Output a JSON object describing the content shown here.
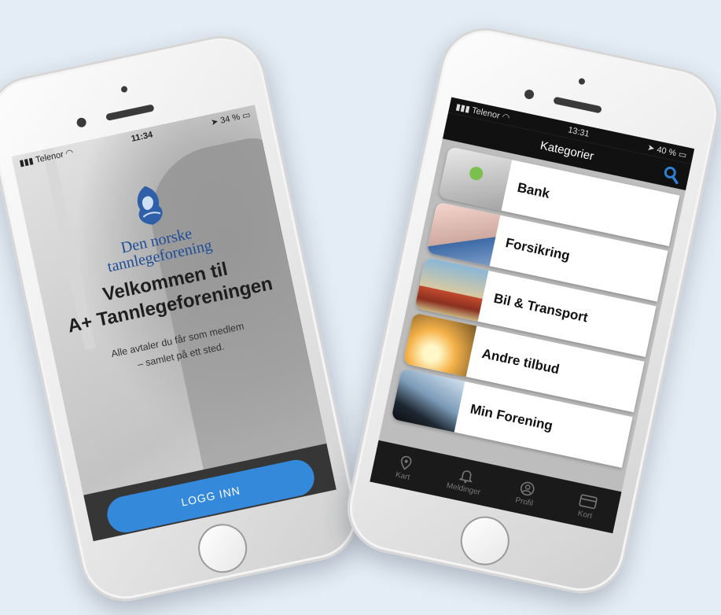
{
  "left_phone": {
    "status": {
      "carrier": "Telenor",
      "time": "11:34",
      "battery": "34 %"
    },
    "logo": {
      "line1": "Den norske",
      "line2": "tannlegeforening"
    },
    "welcome": {
      "line1": "Velkommen til",
      "line2": "A+ Tannlegeforeningen"
    },
    "subtitle": {
      "line1": "Alle avtaler du får som medlem",
      "line2": "– samlet på ett sted."
    },
    "login_label": "LOGG INN"
  },
  "right_phone": {
    "status": {
      "carrier": "Telenor",
      "time": "13:31",
      "battery": "40 %"
    },
    "header_title": "Kategorier",
    "categories": [
      {
        "label": "Bank"
      },
      {
        "label": "Forsikring"
      },
      {
        "label": "Bil & Transport"
      },
      {
        "label": "Andre tilbud"
      },
      {
        "label": "Min Forening"
      }
    ],
    "tabs": [
      {
        "label": "Kart",
        "icon": "map-pin-icon"
      },
      {
        "label": "Meldinger",
        "icon": "bell-icon"
      },
      {
        "label": "Profil",
        "icon": "profile-icon"
      },
      {
        "label": "Kort",
        "icon": "card-icon"
      }
    ]
  },
  "colors": {
    "accent": "#3589da",
    "brand": "#1d4d97",
    "search": "#2f7fd1"
  }
}
